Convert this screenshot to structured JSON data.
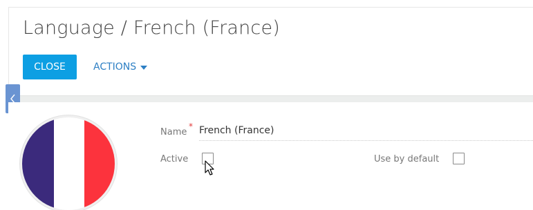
{
  "header": {
    "title": "Language / French (France)",
    "close_label": "CLOSE",
    "actions_label": "ACTIONS"
  },
  "form": {
    "name_label": "Name",
    "name_required": "*",
    "name_value": "French (France)",
    "active_label": "Active",
    "active_checked": false,
    "use_by_default_label": "Use by default",
    "use_by_default_checked": false
  },
  "image": {
    "flag_colors": [
      "#3b2a7c",
      "#ffffff",
      "#fc333d"
    ]
  },
  "colors": {
    "accent": "#0d9fe3",
    "link": "#2d7fc4",
    "collapse_tab": "#6a94d2"
  }
}
